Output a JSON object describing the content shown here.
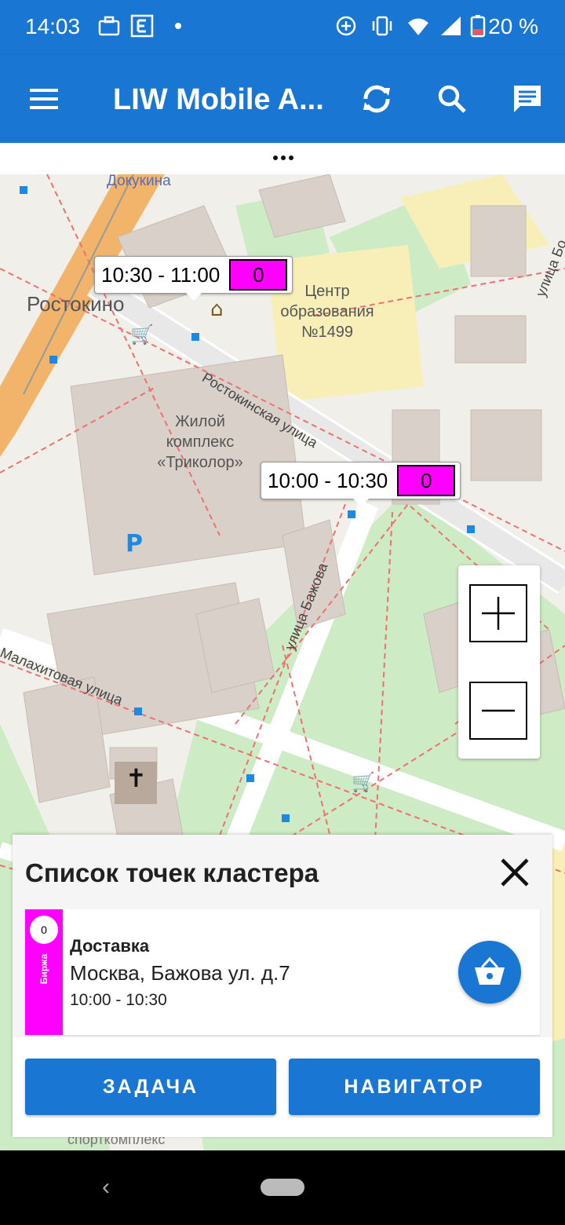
{
  "status_bar": {
    "time": "14:03",
    "battery": "20 %",
    "icons": [
      "briefcase-icon",
      "e-icon",
      "dot-icon",
      "data-saver-icon",
      "vibrate-icon",
      "wifi-icon",
      "signal-icon",
      "battery-icon"
    ]
  },
  "app_bar": {
    "title": "LIW Mobile A...",
    "icons": [
      "menu-icon",
      "sync-icon",
      "search-icon",
      "chat-icon"
    ]
  },
  "map": {
    "labels": {
      "rostokino": "Ростокино",
      "dokukina": "Докукина",
      "center_name": "Центр образования №1499",
      "zhk": "Жилой комплекс «Триколор»",
      "rostokinskaya": "Ростокинская улица",
      "bazhova": "улица Бажова",
      "malakhitovaya": "Малахитовая улица",
      "ulitsa_right": "улица Бо",
      "sport": "спорткомплекс"
    },
    "callouts": [
      {
        "time": "10:30 - 11:00",
        "count": "0"
      },
      {
        "time": "10:00 - 10:30",
        "count": "0"
      }
    ],
    "zoom": {
      "in_label": "+",
      "out_label": "−"
    }
  },
  "cluster_panel": {
    "title": "Список точек кластера",
    "items": [
      {
        "badge_count": "0",
        "stripe_label": "Биржа",
        "type": "Доставка",
        "address": "Москва, Бажова ул. д.7",
        "time": "10:00 - 10:30"
      }
    ],
    "buttons": {
      "task": "ЗАДАЧА",
      "navigator": "НАВИГАТОР"
    }
  },
  "colors": {
    "primary": "#1976d2",
    "badge": "#ff00ff",
    "park": "#cdebc4",
    "building": "#d9d0c9"
  }
}
